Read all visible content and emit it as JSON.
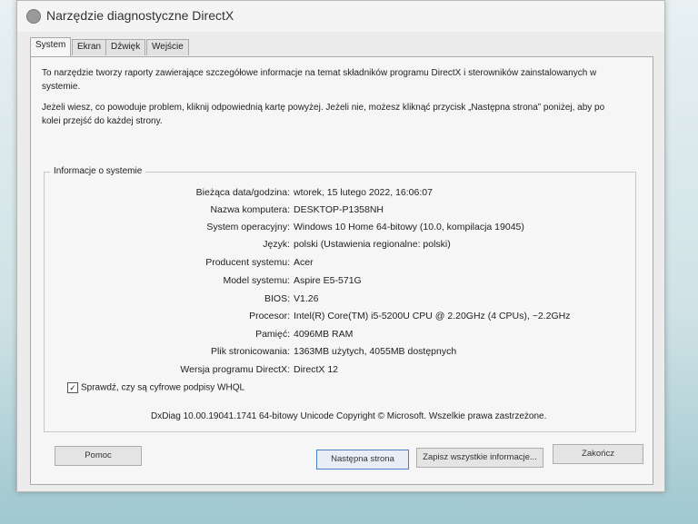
{
  "window": {
    "title": "Narzędzie diagnostyczne DirectX"
  },
  "tabs": [
    {
      "label": "System"
    },
    {
      "label": "Ekran"
    },
    {
      "label": "Dźwięk"
    },
    {
      "label": "Wejście"
    }
  ],
  "intro": {
    "line1": "To narzędzie tworzy raporty zawierające szczegółowe informacje na temat składników programu DirectX i sterowników zainstalowanych w",
    "line2": "systemie.",
    "line3": "Jeżeli wiesz, co powoduje problem, kliknij odpowiednią kartę powyżej. Jeżeli nie, możesz kliknąć przycisk „Następna strona” poniżej, aby po",
    "line4": "kolei przejść do każdej strony."
  },
  "group": {
    "title": "Informacje o systemie",
    "rows": [
      {
        "label": "Bieżąca data/godzina:",
        "value": "wtorek, 15 lutego 2022, 16:06:07"
      },
      {
        "label": "Nazwa komputera:",
        "value": "DESKTOP-P1358NH"
      },
      {
        "label": "System operacyjny:",
        "value": "Windows 10 Home 64-bitowy (10.0, kompilacja 19045)"
      },
      {
        "label": "Język:",
        "value": "polski (Ustawienia regionalne: polski)"
      },
      {
        "label": "Producent systemu:",
        "value": "Acer"
      },
      {
        "label": "Model systemu:",
        "value": "Aspire E5-571G"
      },
      {
        "label": "BIOS:",
        "value": "V1.26"
      },
      {
        "label": "Procesor:",
        "value": "Intel(R) Core(TM) i5-5200U CPU @ 2.20GHz (4 CPUs), ~2.2GHz"
      },
      {
        "label": "Pamięć:",
        "value": "4096MB RAM"
      },
      {
        "label": "Plik stronicowania:",
        "value": "1363MB użytych, 4055MB dostępnych"
      },
      {
        "label": "Wersja programu DirectX:",
        "value": "DirectX 12"
      }
    ]
  },
  "whql": {
    "label": "Sprawdź, czy są cyfrowe podpisy WHQL",
    "checked": true
  },
  "copyright": "DxDiag 10.00.19041.1741 64-bitowy Unicode  Copyright © Microsoft. Wszelkie prawa zastrzeżone.",
  "buttons": {
    "help": "Pomoc",
    "next": "Następna strona",
    "save": "Zapisz wszystkie informacje...",
    "exit": "Zakończ"
  }
}
